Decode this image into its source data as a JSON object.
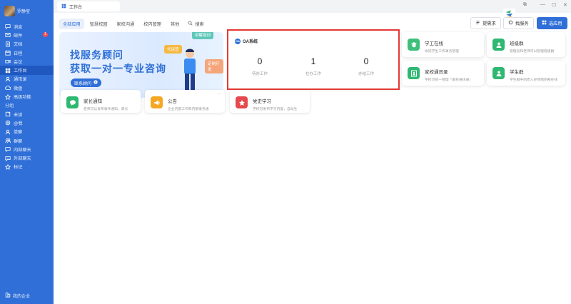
{
  "sidebar": {
    "user_name": "罗静莹",
    "nav": [
      {
        "label": "消息",
        "icon": "message-icon"
      },
      {
        "label": "邮件",
        "icon": "mail-icon",
        "badge": "1"
      },
      {
        "label": "文档",
        "icon": "document-icon"
      },
      {
        "label": "日程",
        "icon": "calendar-icon"
      },
      {
        "label": "会议",
        "icon": "meeting-icon"
      },
      {
        "label": "工作台",
        "icon": "workbench-icon",
        "active": true
      },
      {
        "label": "通讯录",
        "icon": "contacts-icon"
      },
      {
        "label": "微盘",
        "icon": "drive-icon"
      },
      {
        "label": "高级功能",
        "icon": "advanced-icon"
      }
    ],
    "group_label": "分组",
    "groups": [
      {
        "label": "未读",
        "icon": "unread-icon"
      },
      {
        "label": "@我",
        "icon": "mention-icon"
      },
      {
        "label": "单聊",
        "icon": "single-chat-icon"
      },
      {
        "label": "群聊",
        "icon": "group-chat-icon"
      },
      {
        "label": "内部聊天",
        "icon": "internal-chat-icon"
      },
      {
        "label": "外部聊天",
        "icon": "external-chat-icon"
      },
      {
        "label": "标记",
        "icon": "star-icon"
      }
    ],
    "enterprise": "我的企业"
  },
  "window": {
    "tab_title": "工作台"
  },
  "filters": {
    "tabs": [
      "全部应用",
      "智慧校园",
      "家校沟通",
      "校内管理",
      "其他"
    ],
    "search_label": "搜索"
  },
  "toolbar": {
    "request": "提需求",
    "find_service": "找服务",
    "add_app": "选应用"
  },
  "banner": {
    "line1": "找服务顾问",
    "line2": "获取一对一专业咨询",
    "button": "联系顾问",
    "tag1": "讲解培训",
    "tag2": "代运营",
    "tag3": "定制开发"
  },
  "oa": {
    "logo": "OA",
    "title": "OA系统",
    "stats": [
      {
        "value": "0",
        "label": "待办工作"
      },
      {
        "value": "1",
        "label": "在办工作"
      },
      {
        "value": "0",
        "label": "办结工作"
      }
    ]
  },
  "right_apps": [
    {
      "name": "学工在线",
      "desc": "协同学生工作事务管理",
      "color": "#3ec07a",
      "icon": "graduation-icon"
    },
    {
      "name": "班级群",
      "desc": "管理员和老师可以管理班级群",
      "color": "#2eb872",
      "icon": "class-group-icon"
    },
    {
      "name": "家校通讯录",
      "desc": "学校可统一管理「家校通讯录」",
      "color": "#2eb872",
      "icon": "address-book-icon"
    },
    {
      "name": "学生群",
      "desc": "学生群中的老人史师组织部在线",
      "color": "#2eb872",
      "icon": "student-group-icon"
    }
  ],
  "bottom_apps": [
    {
      "name": "家长通知",
      "desc": "老师可以发布事件通知，家长",
      "color": "#2eb872",
      "icon": "chat-bubble-icon"
    },
    {
      "name": "公告",
      "desc": "企业内部工作和内部事务通",
      "color": "#f5a623",
      "icon": "megaphone-icon",
      "more": "···"
    },
    {
      "name": "党史学习",
      "desc": "学校可发布学习内容，自动生",
      "color": "#e5484d",
      "icon": "party-star-icon"
    }
  ]
}
